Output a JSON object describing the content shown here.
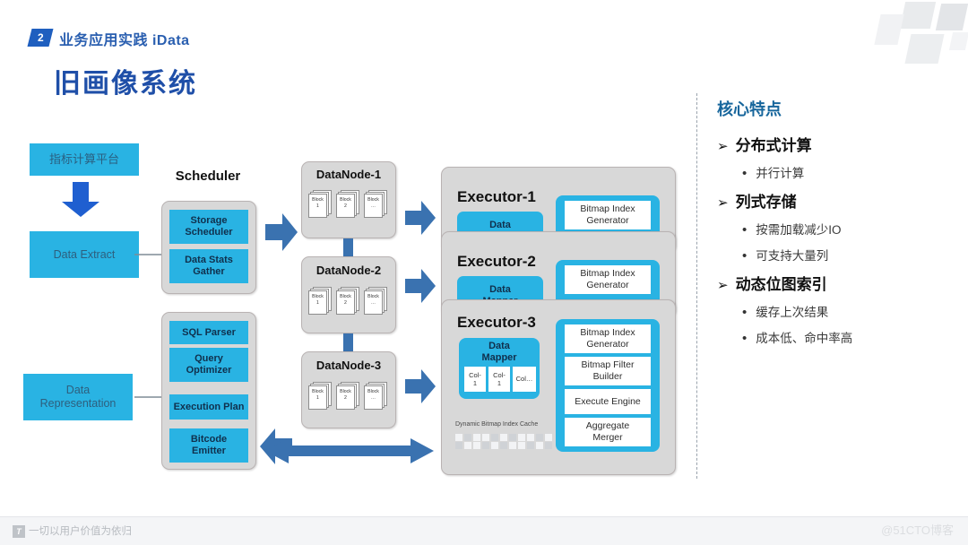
{
  "header": {
    "badge_number": "2",
    "kicker": "业务应用实践 iData",
    "title": "旧画像系统"
  },
  "panel": {
    "heading": "核心特点",
    "arrow_glyph": "➢",
    "bullet_glyph": "•",
    "features": [
      {
        "title": "分布式计算",
        "subs": [
          "并行计算"
        ]
      },
      {
        "title": "列式存储",
        "subs": [
          "按需加载减少IO",
          "可支持大量列"
        ]
      },
      {
        "title": "动态位图索引",
        "subs": [
          "缓存上次结果",
          "成本低、命中率高"
        ]
      }
    ]
  },
  "diagram": {
    "left_column": {
      "platform": "指标计算平台",
      "data_extract": "Data Extract",
      "data_representation": "Data\nRepresentation"
    },
    "scheduler": {
      "heading": "Scheduler",
      "group1": [
        "Storage\nScheduler",
        "Data Stats\nGather"
      ],
      "group2": [
        "SQL Parser",
        "Query\nOptimizer",
        "Execution Plan",
        "Bitcode\nEmitter"
      ]
    },
    "datanodes": [
      {
        "title": "DataNode-1",
        "blocks": [
          "Block\n1",
          "Block\n2",
          "Block\n…"
        ]
      },
      {
        "title": "DataNode-2",
        "blocks": [
          "Block\n1",
          "Block\n2",
          "Block\n…"
        ]
      },
      {
        "title": "DataNode-3",
        "blocks": [
          "Block\n1",
          "Block\n2",
          "Block\n…"
        ]
      }
    ],
    "executors": [
      {
        "title": "Executor-1",
        "mapper": "Data\nMapper",
        "ops": [
          "Bitmap Index\nGenerator"
        ]
      },
      {
        "title": "Executor-2",
        "mapper": "Data\nMapper",
        "ops": [
          "Bitmap Index\nGenerator"
        ]
      },
      {
        "title": "Executor-3",
        "mapper": "Data\nMapper",
        "mapper_cols": [
          "Col-\n1",
          "Col-\n1",
          "Col…"
        ],
        "ops": [
          "Bitmap Index\nGenerator",
          "Bitmap Filter\nBuilder",
          "Execute Engine",
          "Aggregate\nMerger"
        ],
        "cache_label": "Dynamic Bitmap Index Cache"
      }
    ]
  },
  "footer": {
    "mark": "T",
    "slogan": "一切以用户价值为依归",
    "watermark": "@51CTO博客"
  },
  "colors": {
    "cyan": "#29b3e3",
    "brand_blue": "#1f4fa8",
    "steel_arrow": "#3a72b0",
    "gray_panel": "#d8d8d8",
    "heading_teal": "#17669c"
  }
}
